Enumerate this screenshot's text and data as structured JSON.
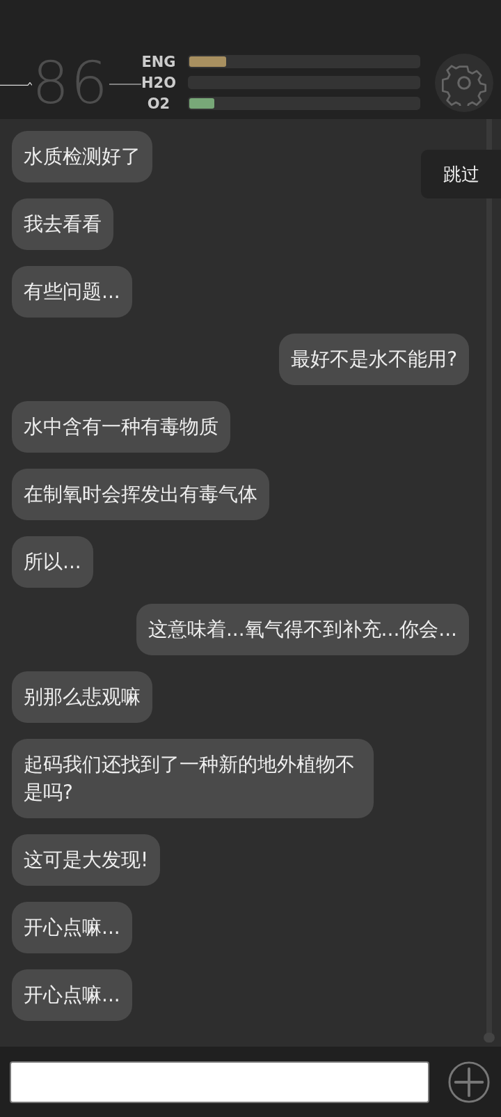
{
  "header": {
    "gauge_value": "86",
    "meters": [
      {
        "label": "ENG",
        "level": 0.16,
        "color": "#a89060"
      },
      {
        "label": "H2O"
      },
      {
        "label": "O2",
        "level": 0.11,
        "color": "#78a878"
      }
    ]
  },
  "skip_button": {
    "label": "跳过"
  },
  "messages": [
    {
      "text": "水质检测好了",
      "kind": "received"
    },
    {
      "text": "我去看看",
      "kind": "received"
    },
    {
      "text": "有些问题...",
      "kind": "received"
    },
    {
      "text": "最好不是水不能用?",
      "kind": "sent"
    },
    {
      "text": "水中含有一种有毒物质",
      "kind": "received"
    },
    {
      "text": "在制氧时会挥发出有毒气体",
      "kind": "received"
    },
    {
      "text": "所以...",
      "kind": "received"
    },
    {
      "text": "这意味着...氧气得不到补充...你会...",
      "kind": "sent"
    },
    {
      "text": "别那么悲观嘛",
      "kind": "received"
    },
    {
      "text": "起码我们还找到了一种新的地外植物不是吗?",
      "kind": "received"
    },
    {
      "text": "这可是大发现!",
      "kind": "received"
    },
    {
      "text": "开心点嘛...",
      "kind": "received"
    },
    {
      "text": "开心点嘛...",
      "kind": "received"
    }
  ]
}
